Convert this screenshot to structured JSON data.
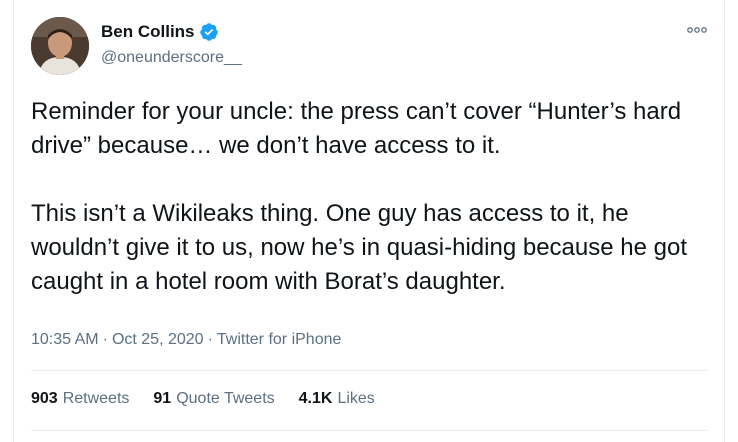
{
  "author": {
    "display_name": "Ben Collins",
    "handle": "@oneunderscore__",
    "verified": true
  },
  "tweet": {
    "paragraphs": [
      "Reminder for your uncle: the press can’t cover “Hunter’s hard drive” because… we don’t have access to it.",
      "This isn’t a Wikileaks thing. One guy has access to it, he wouldn’t give it to us, now he’s in quasi-hiding because he got caught in a hotel room with Borat’s daughter."
    ]
  },
  "meta": {
    "time": "10:35 AM",
    "separator": "·",
    "date": "Oct 25, 2020",
    "source": "Twitter for iPhone"
  },
  "stats": {
    "retweets": {
      "count": "903",
      "label": "Retweets"
    },
    "quote_tweets": {
      "count": "91",
      "label": "Quote Tweets"
    },
    "likes": {
      "count": "4.1K",
      "label": "Likes"
    }
  },
  "colors": {
    "verified": "#1da1f2",
    "secondary_text": "#5b7083",
    "primary_text": "#0f1419"
  },
  "icons": {
    "verified": "verified-badge-icon",
    "more": "more-options-icon"
  }
}
